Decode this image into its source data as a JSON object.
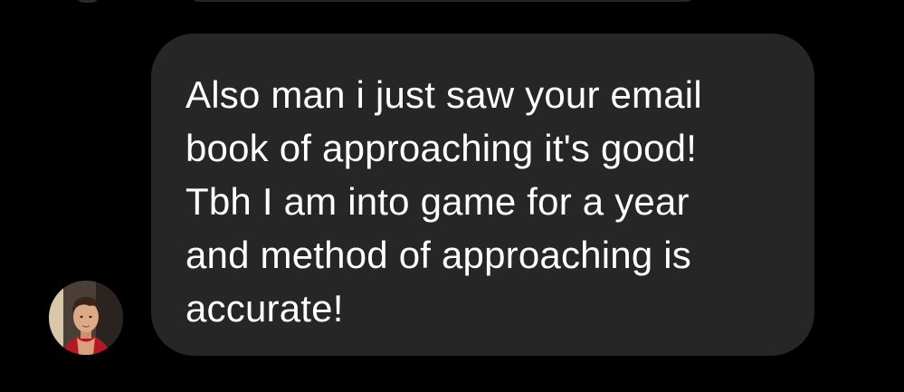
{
  "conversation": {
    "received_message": {
      "text": "Also man i just saw your email\nbook of approaching it's good!\nTbh I am into game for a year\nand method of approaching is\naccurate!"
    },
    "sender": {
      "avatar_icon": "profile-photo-avatar"
    }
  },
  "colors": {
    "background": "#000000",
    "bubble": "#262626",
    "text": "#ffffff"
  }
}
